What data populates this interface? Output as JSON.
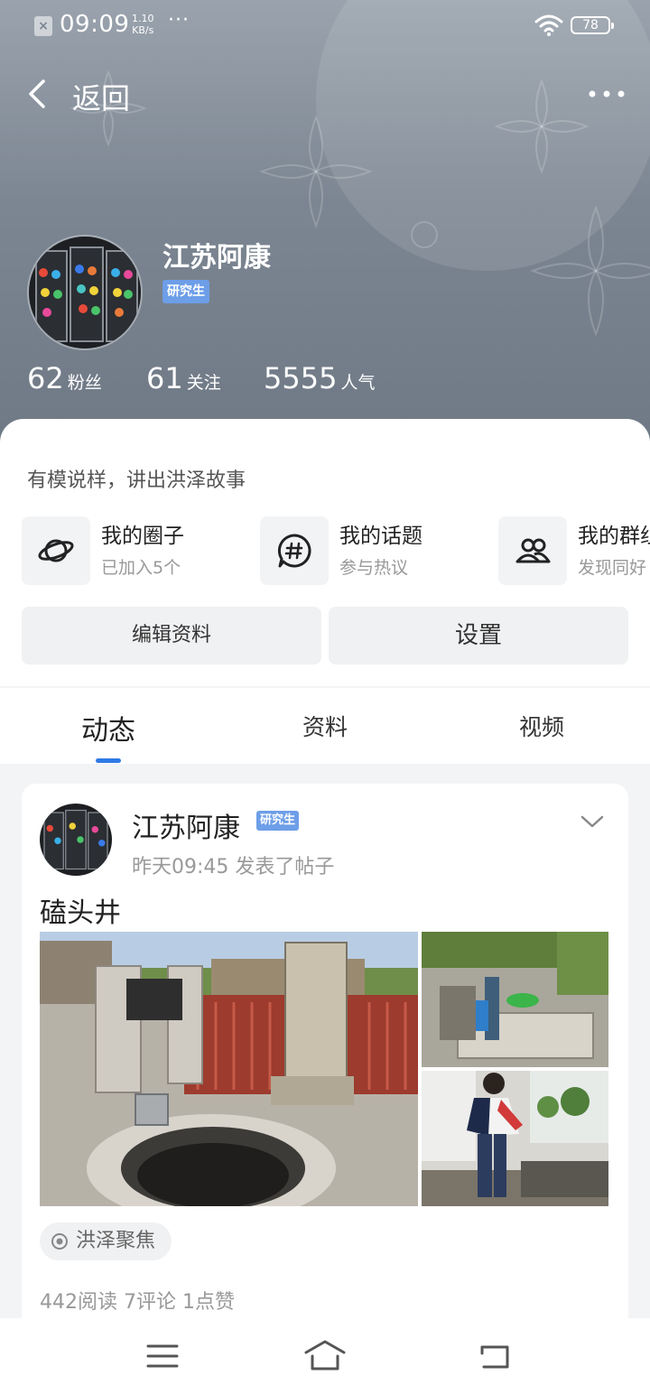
{
  "status_bar": {
    "time": "09:09",
    "speed_value": "1.10",
    "speed_unit": "KB/s",
    "dots": "···",
    "battery": "78",
    "icons": [
      "notification-off-icon",
      "wifi-icon",
      "battery-icon"
    ]
  },
  "header": {
    "back_label": "返回",
    "icons": [
      "back-chevron-icon",
      "more-icon"
    ]
  },
  "profile": {
    "name": "江苏阿康",
    "badge": "研究生",
    "stats": [
      {
        "value": "62",
        "label": "粉丝"
      },
      {
        "value": "61",
        "label": "关注"
      },
      {
        "value": "5555",
        "label": "人气"
      }
    ]
  },
  "panel": {
    "slogan": "有模说样，讲出洪泽故事",
    "quick_links": [
      {
        "title": "我的圈子",
        "subtitle": "已加入5个",
        "icon": "planet-icon"
      },
      {
        "title": "我的话题",
        "subtitle": "参与热议",
        "icon": "hashtag-icon"
      },
      {
        "title": "我的群组",
        "subtitle": "发现同好",
        "icon": "group-icon"
      }
    ],
    "buttons": {
      "edit_profile": "编辑资料",
      "settings": "设置"
    }
  },
  "tabs": [
    {
      "label": "动态",
      "active": true
    },
    {
      "label": "资料",
      "active": false
    },
    {
      "label": "视频",
      "active": false
    }
  ],
  "post": {
    "author": "江苏阿康",
    "badge": "研究生",
    "time": "昨天09:45",
    "action": "发表了帖子",
    "title": "磕头井",
    "photos": [
      "well-monument-photo",
      "water-pump-photo",
      "man-at-well-photo"
    ],
    "topic": "洪泽聚焦",
    "stats_text": "442阅读 7评论 1点赞"
  },
  "nav_bar": {
    "icons": [
      "menu-icon",
      "home-icon",
      "back-icon"
    ]
  },
  "colors": {
    "accent": "#2f7ae5",
    "badge": "#6d9ee8",
    "hero_bg": "#7c8692"
  }
}
